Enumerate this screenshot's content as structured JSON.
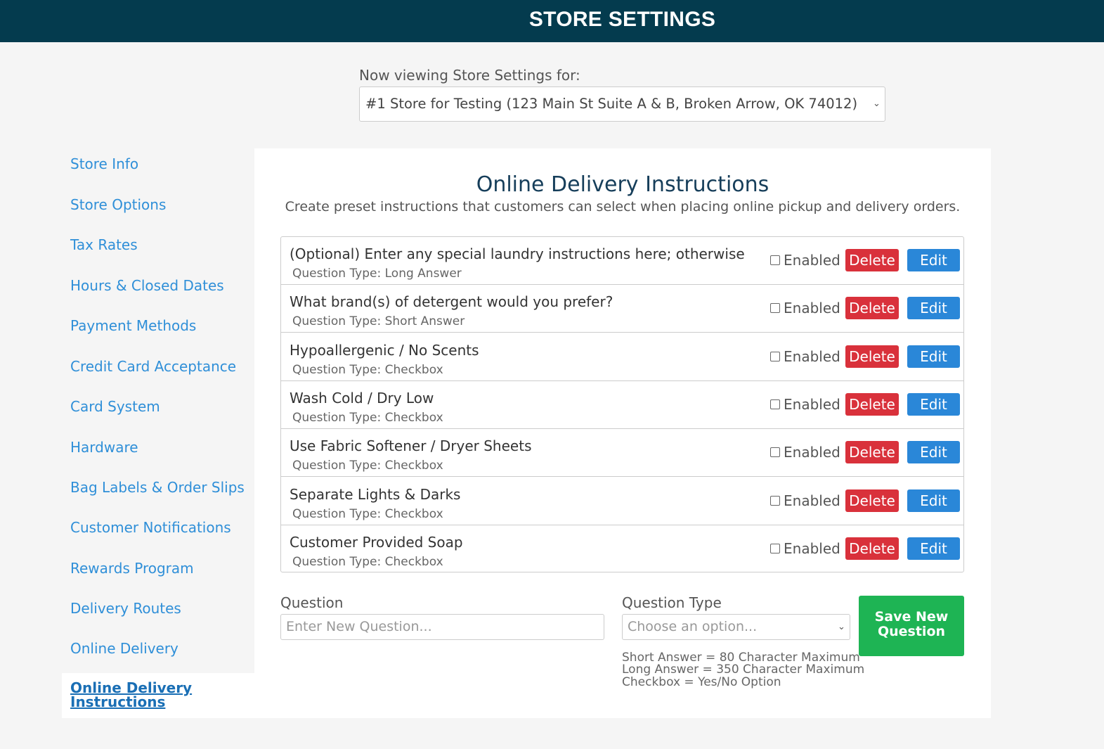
{
  "header": {
    "title": "STORE SETTINGS"
  },
  "store_picker": {
    "label": "Now viewing Store Settings for:",
    "selected": "#1 Store for Testing (123 Main St Suite A & B, Broken Arrow, OK 74012)"
  },
  "sidebar": {
    "items": [
      {
        "label": "Store Info"
      },
      {
        "label": "Store Options"
      },
      {
        "label": "Tax Rates"
      },
      {
        "label": "Hours & Closed Dates"
      },
      {
        "label": "Payment Methods"
      },
      {
        "label": "Credit Card Acceptance"
      },
      {
        "label": "Card System"
      },
      {
        "label": "Hardware"
      },
      {
        "label": "Bag Labels & Order Slips"
      },
      {
        "label": "Customer Notifications"
      },
      {
        "label": "Rewards Program"
      },
      {
        "label": "Delivery Routes"
      },
      {
        "label": "Online Delivery"
      }
    ],
    "active_label": "Online Delivery Instructions"
  },
  "panel": {
    "title": "Online Delivery Instructions",
    "subtitle": "Create preset instructions that customers can select when placing online pickup and delivery orders."
  },
  "questions": [
    {
      "text": "(Optional) Enter any special laundry instructions here; otherwise standard",
      "type": "Question Type: Long Answer",
      "enabled": false
    },
    {
      "text": "What brand(s) of detergent would you prefer?",
      "type": "Question Type: Short Answer",
      "enabled": false
    },
    {
      "text": "Hypoallergenic / No Scents",
      "type": "Question Type: Checkbox",
      "enabled": false
    },
    {
      "text": "Wash Cold / Dry Low",
      "type": "Question Type: Checkbox",
      "enabled": false
    },
    {
      "text": "Use Fabric Softener / Dryer Sheets",
      "type": "Question Type: Checkbox",
      "enabled": false
    },
    {
      "text": "Separate Lights & Darks",
      "type": "Question Type: Checkbox",
      "enabled": false
    },
    {
      "text": "Customer Provided Soap",
      "type": "Question Type: Checkbox",
      "enabled": false
    }
  ],
  "row_labels": {
    "enabled": "Enabled",
    "delete": "Delete",
    "edit": "Edit"
  },
  "new_question": {
    "question_label": "Question",
    "question_placeholder": "Enter New Question...",
    "type_label": "Question Type",
    "type_placeholder": "Choose an option...",
    "hints": [
      "Short Answer = 80 Character Maximum",
      "Long Answer = 350 Character Maximum",
      "Checkbox = Yes/No Option"
    ],
    "save_label": "Save New Question"
  },
  "colors": {
    "header_bg": "#043b4e",
    "link": "#2f8fd8",
    "delete": "#d9313b",
    "edit": "#2a87d8",
    "save": "#1eb454"
  }
}
